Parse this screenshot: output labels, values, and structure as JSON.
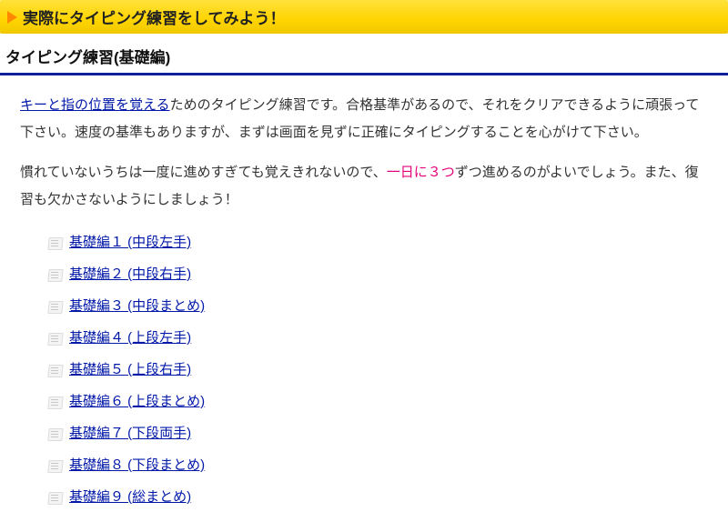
{
  "banner": {
    "title": "実際にタイピング練習をしてみよう！"
  },
  "subhead": "タイピング練習(基礎編)",
  "intro": {
    "link_text": "キーと指の位置を覚える",
    "after_link": "ためのタイピング練習です。合格基準があるので、それをクリアできるように頑張って下さい。速度の基準もありますが、まずは画面を見ずに正確にタイピングすることを心がけて下さい。"
  },
  "advice": {
    "before_highlight": "慣れていないうちは一度に進めすぎても覚えきれないので、",
    "highlight": "一日に３つ",
    "after_highlight": "ずつ進めるのがよいでしょう。また、復習も欠かさないようにしましょう！"
  },
  "lessons": [
    {
      "label": "基礎編１ (中段左手)"
    },
    {
      "label": "基礎編２ (中段右手)"
    },
    {
      "label": "基礎編３ (中段まとめ)"
    },
    {
      "label": "基礎編４ (上段左手)"
    },
    {
      "label": "基礎編５ (上段右手)"
    },
    {
      "label": "基礎編６ (上段まとめ)"
    },
    {
      "label": "基礎編７ (下段両手)"
    },
    {
      "label": "基礎編８ (下段まとめ)"
    },
    {
      "label": "基礎編９ (総まとめ)"
    }
  ]
}
